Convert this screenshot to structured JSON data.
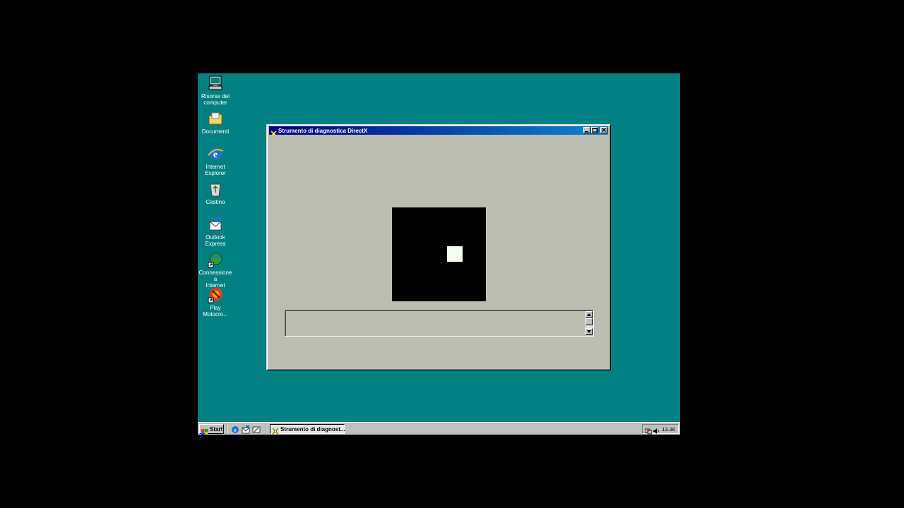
{
  "desktop": {
    "icons": [
      {
        "label": "Risorse del\ncomputer",
        "icon": "my-computer-icon"
      },
      {
        "label": "Documenti",
        "icon": "documents-folder-icon"
      },
      {
        "label": "Internet\nExplorer",
        "icon": "internet-explorer-icon"
      },
      {
        "label": "Cestino",
        "icon": "recycle-bin-icon"
      },
      {
        "label": "Outlook\nExpress",
        "icon": "outlook-express-icon"
      },
      {
        "label": "Connessione a\nInternet",
        "icon": "internet-connection-icon"
      },
      {
        "label": "Play\nMotocro...",
        "icon": "motocross-game-icon"
      }
    ],
    "background_color": "#008080"
  },
  "window": {
    "title": "Strumento di diagnostica DirectX",
    "title_icon": "directx-icon",
    "controls": [
      "minimize-icon",
      "maximize-icon",
      "close-icon"
    ],
    "viewport": {
      "background": "#000000",
      "square_color": "#f4fbf0"
    },
    "log_text": ""
  },
  "taskbar": {
    "start_label": "Start",
    "quick_launch": [
      "internet-explorer-icon",
      "outlook-express-icon",
      "show-desktop-icon"
    ],
    "task_button_label": "Strumento di diagnost...",
    "clock": "13.36",
    "tray_icons": [
      "network-icon",
      "volume-icon"
    ]
  }
}
